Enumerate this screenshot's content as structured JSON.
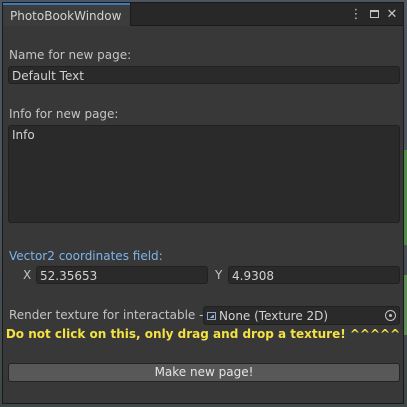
{
  "window": {
    "tab_title": "PhotoBookWindow",
    "tools": {
      "menu_icon": "kebab-menu-icon",
      "maximize_icon": "maximize-icon",
      "close_icon": "close-icon"
    }
  },
  "form": {
    "name_label": "Name for new page:",
    "name_value": "Default Text",
    "info_label": "Info for new page:",
    "info_value": "Info",
    "vector_label": "Vector2 coordinates field:",
    "x_label": "X",
    "x_value": "52.35653",
    "y_label": "Y",
    "y_value": "4.9308",
    "texture_label": "Render texture for interactable ->",
    "texture_value": "None (Texture 2D)",
    "warning": "Do not click on this, only drag and drop a texture! ^^^^^",
    "make_button": "Make new page!"
  },
  "colors": {
    "accent_tab": "#3a79bb",
    "vector_label": "#7cb5ec",
    "warning": "#f4e142"
  }
}
